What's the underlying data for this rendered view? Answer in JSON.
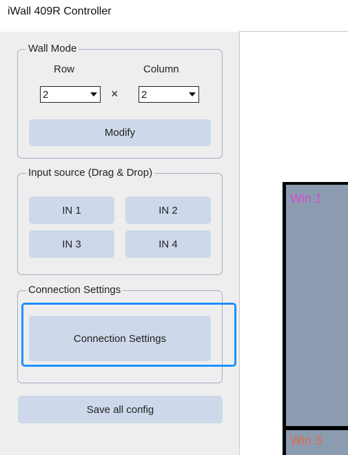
{
  "window": {
    "title": "iWall 409R Controller"
  },
  "wall_mode": {
    "legend": "Wall Mode",
    "row_label": "Row",
    "column_label": "Column",
    "row_value": "2",
    "column_value": "2",
    "times_symbol": "×",
    "modify_label": "Modify"
  },
  "input_source": {
    "legend": "Input source (Drag & Drop)",
    "inputs": [
      "IN 1",
      "IN 2",
      "IN 3",
      "IN 4"
    ]
  },
  "connection": {
    "legend": "Connection Settings",
    "button_label": "Connection Settings"
  },
  "save_label": "Save all config",
  "canvas": {
    "windows": [
      {
        "label": "Win 1",
        "color": "#d14fd1"
      },
      {
        "label": "Win 3",
        "color": "#e06a4a"
      }
    ]
  },
  "colors": {
    "button_bg": "#cdd9ea",
    "focus": "#1e90ff",
    "window_fill": "#8c9cb0"
  }
}
